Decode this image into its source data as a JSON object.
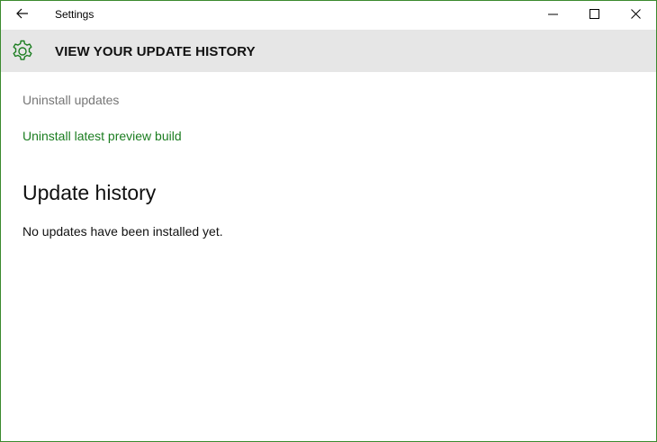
{
  "window": {
    "title": "Settings",
    "back_icon": "back-arrow-icon",
    "controls": {
      "minimize_icon": "minimize-icon",
      "maximize_icon": "maximize-icon",
      "close_icon": "close-icon"
    }
  },
  "header": {
    "icon": "gear-icon",
    "title": "VIEW YOUR UPDATE HISTORY"
  },
  "main": {
    "uninstall_updates_label": "Uninstall updates",
    "uninstall_preview_label": "Uninstall latest preview build",
    "section_heading": "Update history",
    "empty_message": "No updates have been installed yet."
  },
  "colors": {
    "accent": "#1b7d20",
    "header_band": "#e6e6e6",
    "disabled_text": "#767676",
    "window_border": "#3c8a2e"
  }
}
